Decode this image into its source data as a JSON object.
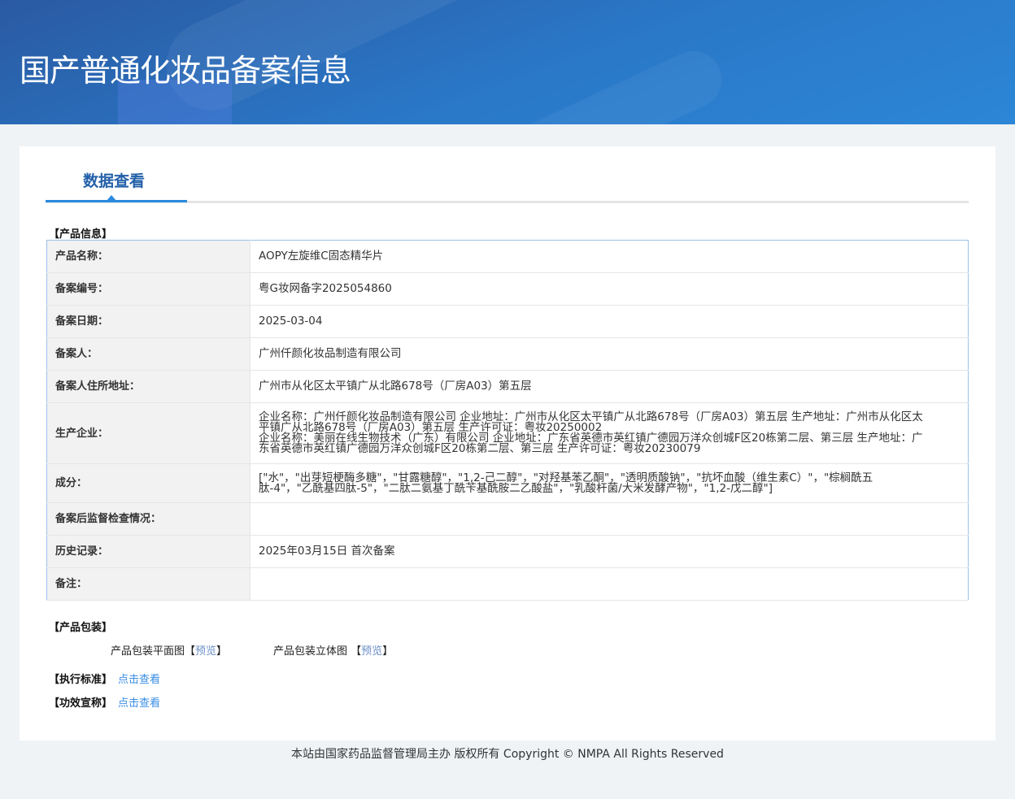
{
  "header": {
    "title": "国产普通化妆品备案信息"
  },
  "tab": {
    "label": "数据查看"
  },
  "sections": {
    "product_info": "【产品信息】",
    "packaging": "【产品包装】",
    "standard": "【执行标准】",
    "efficacy": "【功效宣称】"
  },
  "rows": [
    {
      "label": "产品名称：",
      "value": "AOPY左旋维C固态精华片"
    },
    {
      "label": "备案编号：",
      "value": "粤G妆网备字2025054860"
    },
    {
      "label": "备案日期：",
      "value": "2025-03-04"
    },
    {
      "label": "备案人：",
      "value": "广州仟颜化妆品制造有限公司"
    },
    {
      "label": "备案人住所地址：",
      "value": "广州市从化区太平镇广从北路678号（厂房A03）第五层"
    },
    {
      "label": "生产企业：",
      "value": "企业名称：广州仟颜化妆品制造有限公司 企业地址：广州市从化区太平镇广从北路678号（厂房A03）第五层 生产地址：广州市从化区太平镇广从北路678号（厂房A03）第五层 生产许可证：粤妆20250002",
      "value2": "企业名称：美丽在线生物技术（广东）有限公司 企业地址：广东省英德市英红镇广德园万洋众创城F区20栋第二层、第三层 生产地址：广东省英德市英红镇广德园万洋众创城F区20栋第二层、第三层 生产许可证：粤妆20230079"
    },
    {
      "label": "成分：",
      "value": "[\"水\"，\"出芽短梗酶多糖\"，\"甘露糖醇\"，\"1,2-己二醇\"，\"对羟基苯乙酮\"，\"透明质酸钠\"，\"抗坏血酸（维生素C）\"，\"棕榈酰五肽-4\"，\"乙酰基四肽-5\"，\"二肽二氨基丁酰苄基酰胺二乙酸盐\"，\"乳酸杆菌/大米发酵产物\"，\"1,2-戊二醇\"]"
    },
    {
      "label": "备案后监督检查情况：",
      "value": ""
    },
    {
      "label": "历史记录：",
      "value": "2025年03月15日 首次备案"
    },
    {
      "label": "备注：",
      "value": ""
    }
  ],
  "packaging": {
    "flat_label": "产品包装平面图",
    "solid_label": "产品包装立体图",
    "preview": "预览",
    "lb": "【",
    "rb": "】"
  },
  "links": {
    "view": "点击查看"
  },
  "footer": "本站由国家药品监督管理局主办 版权所有 Copyright © NMPA All Rights Reserved"
}
